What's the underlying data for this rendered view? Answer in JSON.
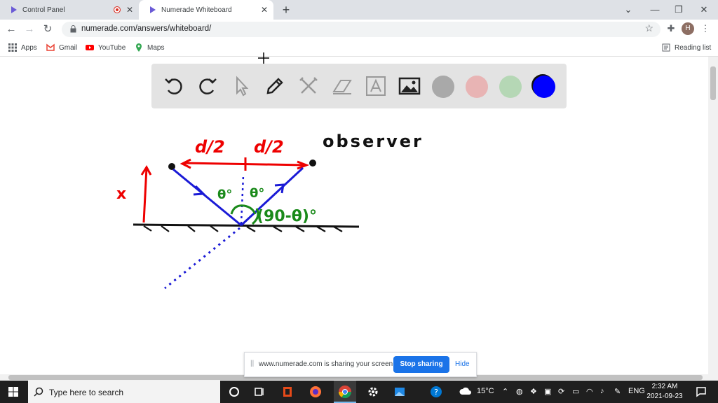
{
  "browser": {
    "tabs": [
      {
        "title": "Control Panel",
        "active": false,
        "recording": true
      },
      {
        "title": "Numerade Whiteboard",
        "active": true
      }
    ],
    "url": "numerade.com/answers/whiteboard/",
    "bookmarks": [
      "Apps",
      "Gmail",
      "YouTube",
      "Maps"
    ],
    "reading_list": "Reading list",
    "avatar_initial": "H"
  },
  "whiteboard": {
    "tools": [
      "undo-icon",
      "redo-icon",
      "select-icon",
      "pen-icon",
      "shapes-icon",
      "eraser-icon",
      "text-icon",
      "image-icon"
    ],
    "colors": [
      "#a9a9a9",
      "#e8b4b4",
      "#b5d7b5",
      "#0000ff"
    ],
    "drawing_labels": {
      "half_left": "d/2",
      "half_right": "d/2",
      "height": "x",
      "observer": "observer",
      "theta_left": "θ°",
      "theta_right": "θ°",
      "complement": "(90-θ)°"
    }
  },
  "sharing_bar": {
    "message": "www.numerade.com is sharing your screen.",
    "stop_label": "Stop sharing",
    "hide_label": "Hide"
  },
  "taskbar": {
    "search_placeholder": "Type here to search",
    "temperature": "15°C",
    "language": "ENG",
    "time": "2:32 AM",
    "date": "2021-09-23"
  }
}
